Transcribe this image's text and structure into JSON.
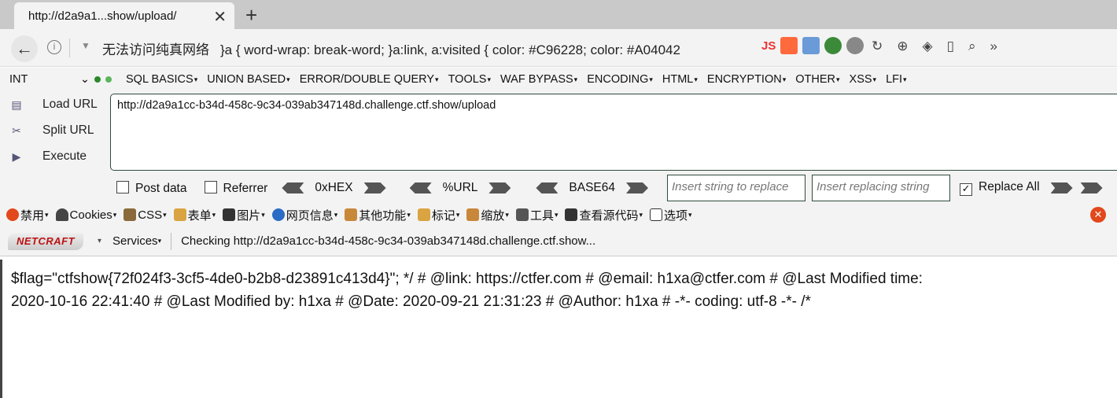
{
  "tab": {
    "title": "http://d2a9a1...show/upload/",
    "close": "✕",
    "new_tab": "+"
  },
  "address": {
    "back": "←",
    "info": "i",
    "dropdown": "▼",
    "error_text": "无法访问纯真网络",
    "css_text": "}a { word-wrap: break-word; }a:link, a:visited { color: #C96228; color: #A04042",
    "ext_label": "JS"
  },
  "hackbar": {
    "int_select": "INT",
    "menus": [
      "SQL BASICS",
      "UNION BASED",
      "ERROR/DOUBLE QUERY",
      "TOOLS",
      "WAF BYPASS",
      "ENCODING",
      "HTML",
      "ENCRYPTION",
      "OTHER",
      "XSS",
      "LFI"
    ],
    "load_url": "Load URL",
    "split_url": "Split URL",
    "execute": "Execute",
    "url_value": "http://d2a9a1cc-b34d-458c-9c34-039ab347148d.challenge.ctf.show/upload",
    "post_data": "Post data",
    "referrer": "Referrer",
    "hex": "0xHEX",
    "urlenc": "%URL",
    "base64": "BASE64",
    "insert_placeholder": "Insert string to replace",
    "replacing_placeholder": "Insert replacing string",
    "replace_all": "Replace All"
  },
  "firework": {
    "items": [
      "禁用",
      "Cookies",
      "CSS",
      "表单",
      "图片",
      "网页信息",
      "其他功能",
      "标记",
      "缩放",
      "工具",
      "查看源代码",
      "选项"
    ]
  },
  "netcraft": {
    "logo": "NETCRAFT",
    "services": "Services",
    "status": "Checking http://d2a9a1cc-b34d-458c-9c34-039ab347148d.challenge.ctf.show..."
  },
  "page": {
    "line1": "$flag=\"ctfshow{72f024f3-3cf5-4de0-b2b8-d23891c413d4}\"; */ # @link: https://ctfer.com # @email: h1xa@ctfer.com # @Last Modified time:",
    "line2": "2020-10-16 22:41:40 # @Last Modified by: h1xa # @Date: 2020-09-21 21:31:23 # @Author: h1xa # -*- coding: utf-8 -*- /*"
  }
}
